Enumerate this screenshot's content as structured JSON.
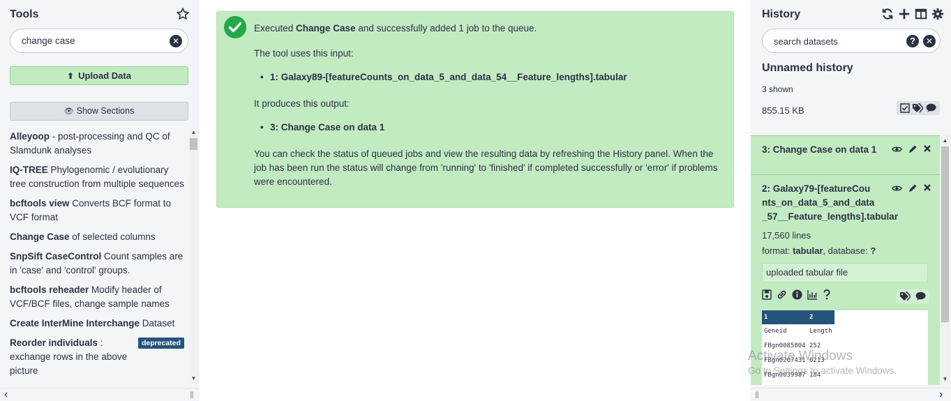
{
  "tools_panel": {
    "title": "Tools",
    "search": {
      "value": "change case"
    },
    "upload_label": "Upload Data",
    "show_sections_label": "Show Sections",
    "tools": [
      {
        "name": "Alleyoop",
        "desc": " - post-processing and QC of Slamdunk analyses"
      },
      {
        "name": "IQ-TREE",
        "desc": " Phylogenomic / evolutionary tree construction from multiple sequences"
      },
      {
        "name": "bcftools view",
        "desc": " Converts BCF format to VCF format"
      },
      {
        "name": "Change Case",
        "desc": " of selected columns"
      },
      {
        "name": "SnpSift CaseControl",
        "desc": " Count samples are in 'case' and 'control' groups."
      },
      {
        "name": "bcftools reheader",
        "desc": " Modify header of VCF/BCF files, change sample names"
      },
      {
        "name": "Create InterMine Interchange",
        "desc": " Dataset"
      },
      {
        "name": "Reorder individuals",
        "desc": " : exchange rows in the above picture",
        "badge": "deprecated"
      }
    ]
  },
  "message": {
    "executed_prefix": "Executed ",
    "tool_name": "Change Case",
    "executed_suffix": " and successfully added 1 job to the queue.",
    "input_label": "The tool uses this input:",
    "input_item": "1: Galaxy89-[featureCounts_on_data_5_and_data_54__Feature_lengths].tabular",
    "output_label": "It produces this output:",
    "output_item": "3: Change Case on data 1",
    "status_text": "You can check the status of queued jobs and view the resulting data by refreshing the History panel. When the job has been run the status will change from 'running' to 'finished' if completed successfully or 'error' if problems were encountered."
  },
  "history": {
    "title": "History",
    "search_placeholder": "search datasets",
    "name": "Unnamed history",
    "shown": "3 shown",
    "size": "855.15 KB",
    "items": [
      {
        "name": "3: Change Case on data 1"
      },
      {
        "name": "2: Galaxy79-[featureCounts_on_data_5_and_data_57__Feature_lengths].tabular",
        "name_lines": [
          "2: Galaxy79-[featureCou",
          "nts_on_data_5_and_data",
          "_57__Feature_lengths].tabular"
        ],
        "lines": "17,560 lines",
        "format_label": "format: ",
        "format": "tabular",
        "database_label": ", database: ",
        "database": "?",
        "info": "uploaded tabular file",
        "peek": {
          "headers": [
            "1",
            "2"
          ],
          "rows": [
            [
              "Geneid",
              "Length"
            ],
            [
              "FBgn0085804",
              "252"
            ],
            [
              "FBgn0267431",
              "6213"
            ],
            [
              "FBgn0039987",
              "184"
            ]
          ]
        }
      }
    ]
  },
  "watermark": {
    "line1": "Activate Windows",
    "line2": "Go to Settings to activate Windows."
  },
  "colors": {
    "success_bg": "#c2ebc2",
    "success_icon": "#25a84a",
    "brand_dark": "#25537b",
    "text": "#2c3143"
  }
}
